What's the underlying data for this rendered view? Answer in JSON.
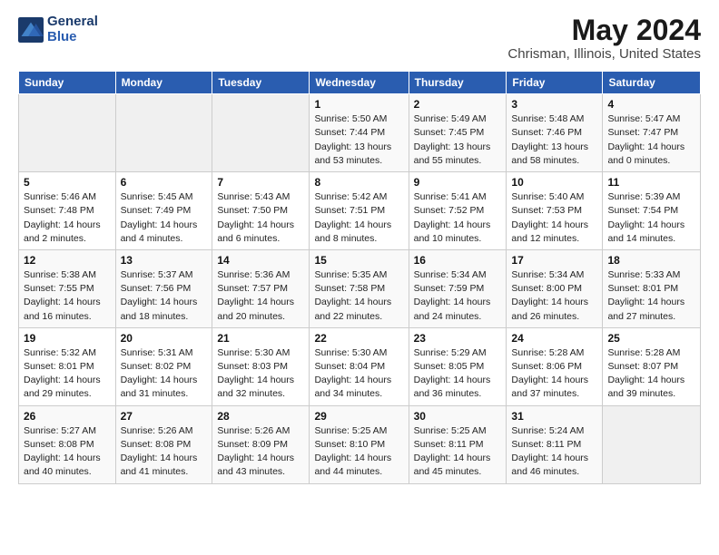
{
  "logo": {
    "line1": "General",
    "line2": "Blue"
  },
  "title": "May 2024",
  "subtitle": "Chrisman, Illinois, United States",
  "weekdays": [
    "Sunday",
    "Monday",
    "Tuesday",
    "Wednesday",
    "Thursday",
    "Friday",
    "Saturday"
  ],
  "weeks": [
    [
      {
        "day": "",
        "info": ""
      },
      {
        "day": "",
        "info": ""
      },
      {
        "day": "",
        "info": ""
      },
      {
        "day": "1",
        "info": "Sunrise: 5:50 AM\nSunset: 7:44 PM\nDaylight: 13 hours\nand 53 minutes."
      },
      {
        "day": "2",
        "info": "Sunrise: 5:49 AM\nSunset: 7:45 PM\nDaylight: 13 hours\nand 55 minutes."
      },
      {
        "day": "3",
        "info": "Sunrise: 5:48 AM\nSunset: 7:46 PM\nDaylight: 13 hours\nand 58 minutes."
      },
      {
        "day": "4",
        "info": "Sunrise: 5:47 AM\nSunset: 7:47 PM\nDaylight: 14 hours\nand 0 minutes."
      }
    ],
    [
      {
        "day": "5",
        "info": "Sunrise: 5:46 AM\nSunset: 7:48 PM\nDaylight: 14 hours\nand 2 minutes."
      },
      {
        "day": "6",
        "info": "Sunrise: 5:45 AM\nSunset: 7:49 PM\nDaylight: 14 hours\nand 4 minutes."
      },
      {
        "day": "7",
        "info": "Sunrise: 5:43 AM\nSunset: 7:50 PM\nDaylight: 14 hours\nand 6 minutes."
      },
      {
        "day": "8",
        "info": "Sunrise: 5:42 AM\nSunset: 7:51 PM\nDaylight: 14 hours\nand 8 minutes."
      },
      {
        "day": "9",
        "info": "Sunrise: 5:41 AM\nSunset: 7:52 PM\nDaylight: 14 hours\nand 10 minutes."
      },
      {
        "day": "10",
        "info": "Sunrise: 5:40 AM\nSunset: 7:53 PM\nDaylight: 14 hours\nand 12 minutes."
      },
      {
        "day": "11",
        "info": "Sunrise: 5:39 AM\nSunset: 7:54 PM\nDaylight: 14 hours\nand 14 minutes."
      }
    ],
    [
      {
        "day": "12",
        "info": "Sunrise: 5:38 AM\nSunset: 7:55 PM\nDaylight: 14 hours\nand 16 minutes."
      },
      {
        "day": "13",
        "info": "Sunrise: 5:37 AM\nSunset: 7:56 PM\nDaylight: 14 hours\nand 18 minutes."
      },
      {
        "day": "14",
        "info": "Sunrise: 5:36 AM\nSunset: 7:57 PM\nDaylight: 14 hours\nand 20 minutes."
      },
      {
        "day": "15",
        "info": "Sunrise: 5:35 AM\nSunset: 7:58 PM\nDaylight: 14 hours\nand 22 minutes."
      },
      {
        "day": "16",
        "info": "Sunrise: 5:34 AM\nSunset: 7:59 PM\nDaylight: 14 hours\nand 24 minutes."
      },
      {
        "day": "17",
        "info": "Sunrise: 5:34 AM\nSunset: 8:00 PM\nDaylight: 14 hours\nand 26 minutes."
      },
      {
        "day": "18",
        "info": "Sunrise: 5:33 AM\nSunset: 8:01 PM\nDaylight: 14 hours\nand 27 minutes."
      }
    ],
    [
      {
        "day": "19",
        "info": "Sunrise: 5:32 AM\nSunset: 8:01 PM\nDaylight: 14 hours\nand 29 minutes."
      },
      {
        "day": "20",
        "info": "Sunrise: 5:31 AM\nSunset: 8:02 PM\nDaylight: 14 hours\nand 31 minutes."
      },
      {
        "day": "21",
        "info": "Sunrise: 5:30 AM\nSunset: 8:03 PM\nDaylight: 14 hours\nand 32 minutes."
      },
      {
        "day": "22",
        "info": "Sunrise: 5:30 AM\nSunset: 8:04 PM\nDaylight: 14 hours\nand 34 minutes."
      },
      {
        "day": "23",
        "info": "Sunrise: 5:29 AM\nSunset: 8:05 PM\nDaylight: 14 hours\nand 36 minutes."
      },
      {
        "day": "24",
        "info": "Sunrise: 5:28 AM\nSunset: 8:06 PM\nDaylight: 14 hours\nand 37 minutes."
      },
      {
        "day": "25",
        "info": "Sunrise: 5:28 AM\nSunset: 8:07 PM\nDaylight: 14 hours\nand 39 minutes."
      }
    ],
    [
      {
        "day": "26",
        "info": "Sunrise: 5:27 AM\nSunset: 8:08 PM\nDaylight: 14 hours\nand 40 minutes."
      },
      {
        "day": "27",
        "info": "Sunrise: 5:26 AM\nSunset: 8:08 PM\nDaylight: 14 hours\nand 41 minutes."
      },
      {
        "day": "28",
        "info": "Sunrise: 5:26 AM\nSunset: 8:09 PM\nDaylight: 14 hours\nand 43 minutes."
      },
      {
        "day": "29",
        "info": "Sunrise: 5:25 AM\nSunset: 8:10 PM\nDaylight: 14 hours\nand 44 minutes."
      },
      {
        "day": "30",
        "info": "Sunrise: 5:25 AM\nSunset: 8:11 PM\nDaylight: 14 hours\nand 45 minutes."
      },
      {
        "day": "31",
        "info": "Sunrise: 5:24 AM\nSunset: 8:11 PM\nDaylight: 14 hours\nand 46 minutes."
      },
      {
        "day": "",
        "info": ""
      }
    ]
  ]
}
